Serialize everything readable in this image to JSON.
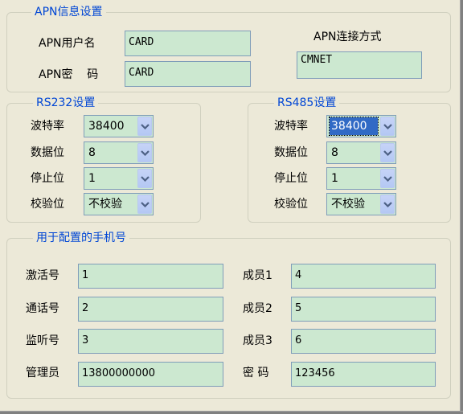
{
  "apn": {
    "title": "APN信息设置",
    "username_label": "APN用户名",
    "username_value": "CARD",
    "password_label": "APN密  码",
    "password_value": "CARD",
    "connect_label": "APN连接方式",
    "connect_value": "CMNET"
  },
  "rs232": {
    "title": "RS232设置",
    "rows": [
      {
        "label": "波特率",
        "value": "38400"
      },
      {
        "label": "数据位",
        "value": "8"
      },
      {
        "label": "停止位",
        "value": "1"
      },
      {
        "label": "校验位",
        "value": "不校验"
      }
    ]
  },
  "rs485": {
    "title": "RS485设置",
    "rows": [
      {
        "label": "波特率",
        "value": "38400"
      },
      {
        "label": "数据位",
        "value": "8"
      },
      {
        "label": "停止位",
        "value": "1"
      },
      {
        "label": "校验位",
        "value": "不校验"
      }
    ]
  },
  "phones": {
    "title": "用于配置的手机号",
    "left": [
      {
        "label": "激活号",
        "value": "1"
      },
      {
        "label": "通话号",
        "value": "2"
      },
      {
        "label": "监听号",
        "value": "3"
      },
      {
        "label": "管理员",
        "value": "13800000000"
      }
    ],
    "right": [
      {
        "label": "成员1",
        "value": "4"
      },
      {
        "label": "成员2",
        "value": "5"
      },
      {
        "label": "成员3",
        "value": "6"
      },
      {
        "label": "密 码",
        "value": "123456"
      }
    ]
  },
  "icons": {
    "dropdown": "chevron-down-icon"
  },
  "colors": {
    "field_bg": "#cce8d0",
    "legend": "#0046d5",
    "selection": "#316ac5"
  }
}
